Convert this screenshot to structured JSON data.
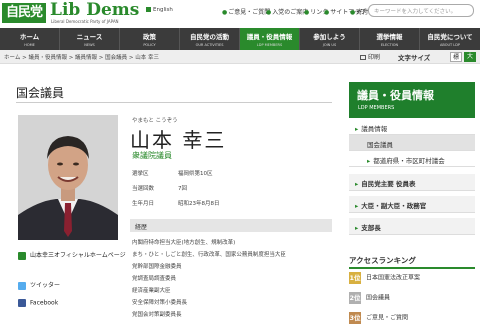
{
  "header": {
    "logo_jp": "自民党",
    "logo_en": "Lib Dems",
    "logo_sub": "Liberal Democratic Party of JAPAN",
    "english_link": "English",
    "util_links": [
      "ご意見・ご質問",
      "入党のご案内",
      "リンク",
      "サイトマップ",
      "寄付"
    ],
    "search_placeholder": "キーワードを入力してください。"
  },
  "nav": [
    {
      "jp": "ホーム",
      "en": "HOME"
    },
    {
      "jp": "ニュース",
      "en": "NEWS"
    },
    {
      "jp": "政策",
      "en": "POLICY"
    },
    {
      "jp": "自民党の活動",
      "en": "OUR ACTIVITIES"
    },
    {
      "jp": "議員・役員情報",
      "en": "LDP MEMBERS"
    },
    {
      "jp": "参加しよう",
      "en": "JOIN US"
    },
    {
      "jp": "選挙情報",
      "en": "ELECTION"
    },
    {
      "jp": "自民党について",
      "en": "ABOUT LDP"
    }
  ],
  "breadcrumb": "ホーム > 議員・役員情報 > 議員情報 > 国会議員 > 山本 幸三",
  "tools": {
    "print": "印刷",
    "font_size": "文字サイズ",
    "size_medium": "標",
    "size_large": "大"
  },
  "page_title": "国会議員",
  "profile": {
    "ruby": "やまもと こうぞう",
    "name": "山本 幸三",
    "role": "衆議院議員",
    "info": [
      {
        "label": "選挙区",
        "value": "福岡県第10区"
      },
      {
        "label": "当選回数",
        "value": "7回"
      },
      {
        "label": "生年月日",
        "value": "昭和23年8月8日"
      }
    ],
    "career_heading": "経歴",
    "career": [
      "内閣府特命担当大臣(地方創生、規制改革)",
      "まち・ひと・しごと創生、行政改革、国家公務員制度担当大臣",
      "党幹部国際金融委員",
      "党調査局調査委員",
      "経済産業副大臣",
      "安全保障対策小委員長",
      "党国会対策副委員長"
    ],
    "links": [
      {
        "icon": "home-icon",
        "label": "山本幸三オフィシャルホームページ"
      },
      {
        "icon": "twitter-icon",
        "label": "ツイッター"
      },
      {
        "icon": "facebook-icon",
        "label": "Facebook"
      }
    ]
  },
  "sidebar": {
    "title": "議員・役員情報",
    "subtitle": "LDP MEMBERS",
    "items": [
      {
        "label": "議員情報",
        "level": 1
      },
      {
        "label": "国会議員",
        "level": 2
      },
      {
        "label": "都道府県・市区町村議会",
        "level": 2
      },
      {
        "label": "自民党主要 役員表",
        "level": 1
      },
      {
        "label": "大臣・副大臣・政務官",
        "level": 1
      },
      {
        "label": "支部長",
        "level": 1
      }
    ],
    "ranking_title": "アクセスランキング",
    "ranking": [
      {
        "rank": "1位",
        "label": "日本国憲法改正草案"
      },
      {
        "rank": "2位",
        "label": "国会議員"
      },
      {
        "rank": "3位",
        "label": "ご意見・ご質問"
      }
    ]
  },
  "colors": {
    "brand_green": "#2a8a2c",
    "nav_bg": "#3b3b3b",
    "sidebar_green": "#1f7f2c"
  }
}
